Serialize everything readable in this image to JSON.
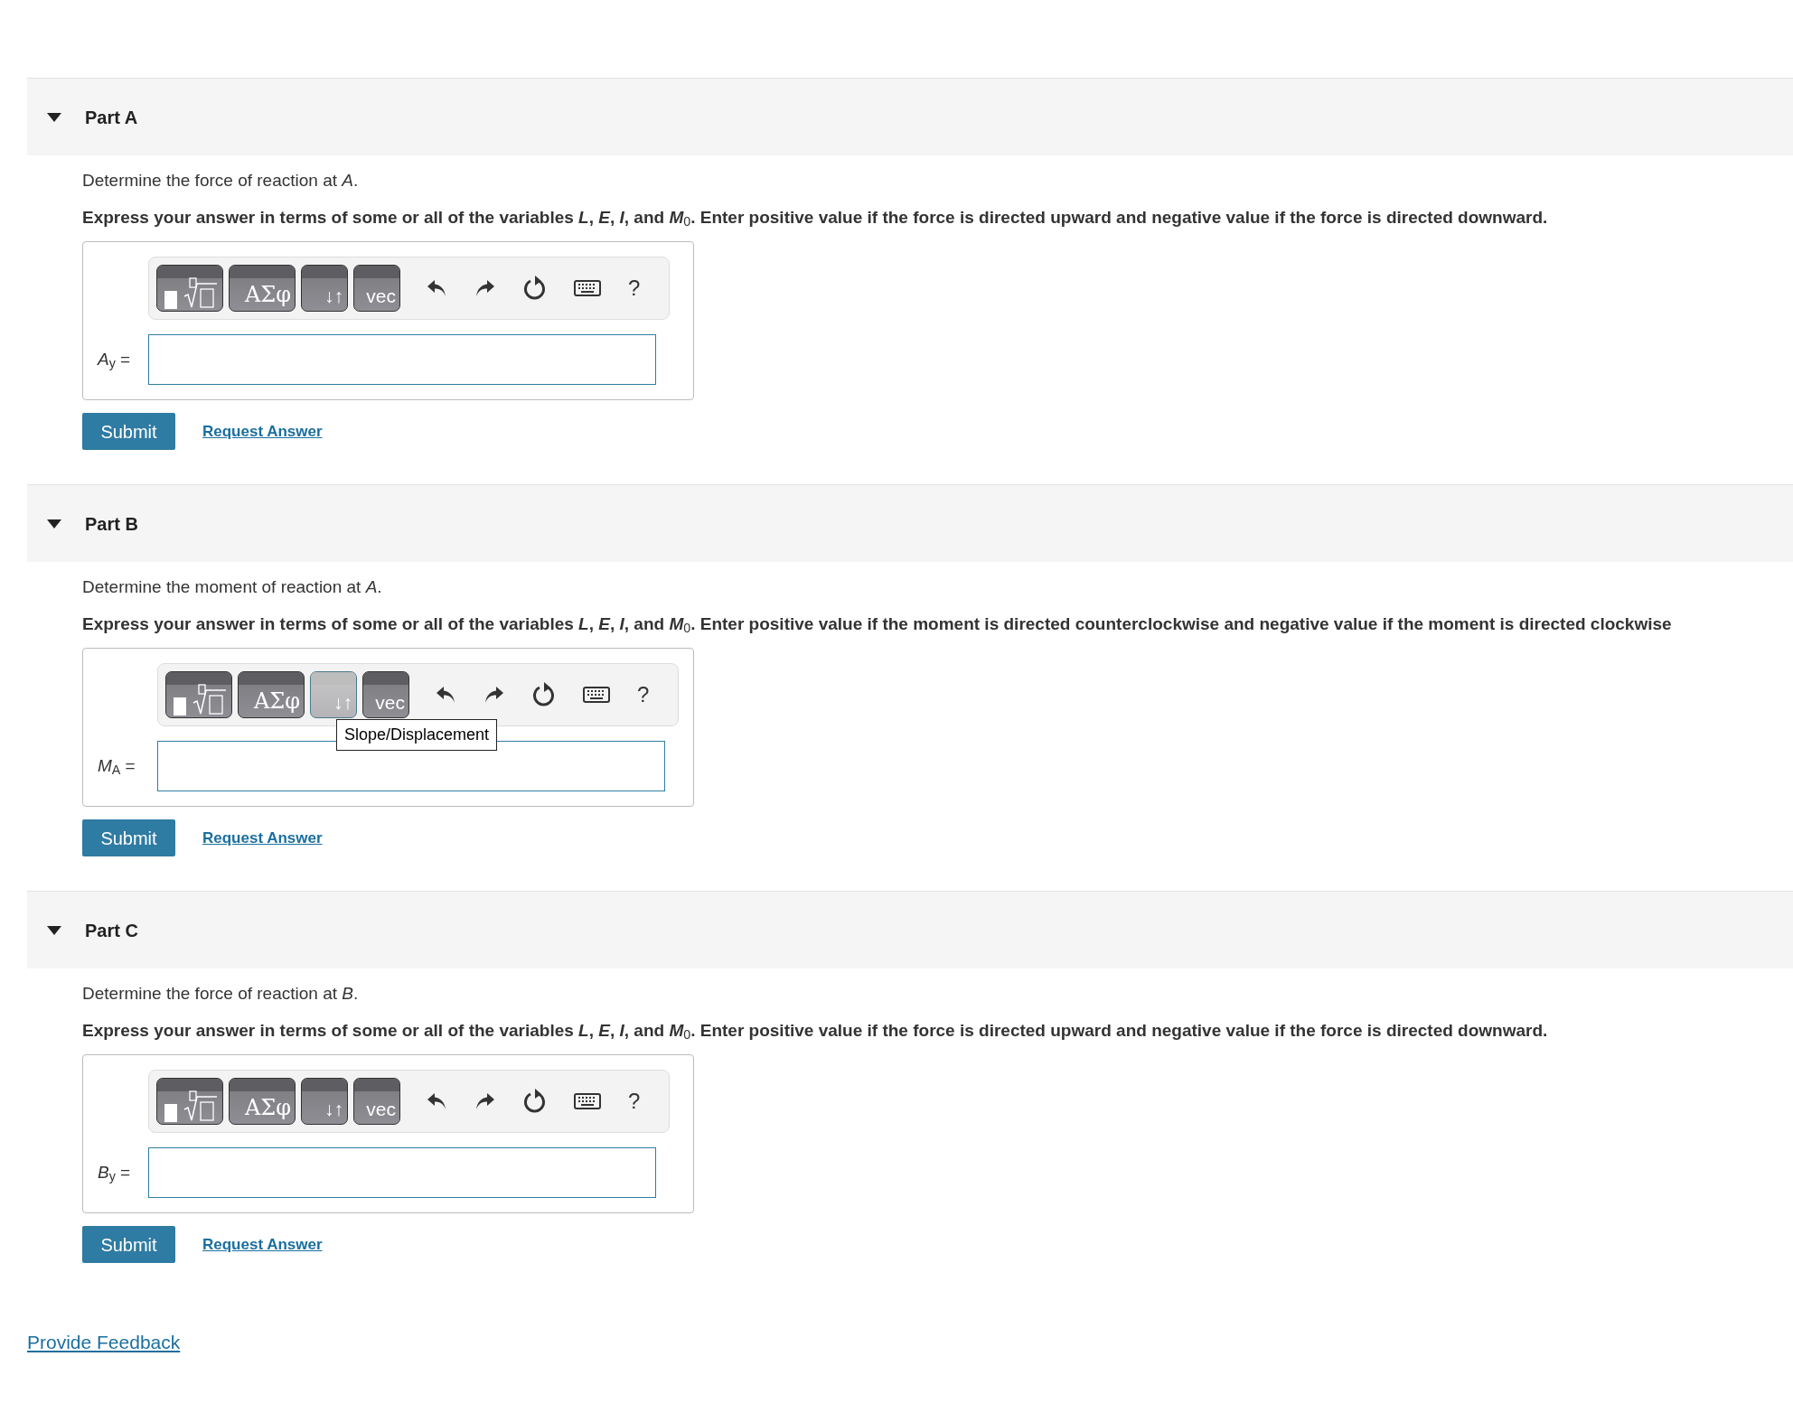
{
  "parts": [
    {
      "title": "Part A",
      "expanded": true,
      "question": "Determine the force of reaction at *A*.",
      "instruction": "Express your answer in terms of some or all of the variables *L*, *E*, *I*, and *M*$_{0}$. Enter positive value if the force is directed upward and negative value if the force is directed downward.",
      "toolbar": [
        {
          "kind": "templates",
          "highlighted": false
        },
        {
          "kind": "symbols",
          "label": "ΑΣφ",
          "highlighted": false
        },
        {
          "kind": "arrows",
          "label": "↓↑",
          "highlighted": false
        },
        {
          "kind": "vector",
          "label": "vec",
          "highlighted": false
        }
      ],
      "help": "?",
      "answer_label": "*A*$_{y}$ =",
      "submit": "Submit",
      "request": "Request Answer"
    },
    {
      "title": "Part B",
      "expanded": true,
      "question": "Determine the moment of reaction at *A*.",
      "instruction": "Express your answer in terms of some or all of the variables *L*, *E*, *I*, and *M*$_{0}$. Enter positive value if the moment is directed counterclockwise and negative value if the moment is directed clockwise",
      "toolbar": [
        {
          "kind": "templates",
          "highlighted": false
        },
        {
          "kind": "symbols",
          "label": "ΑΣφ",
          "highlighted": false
        },
        {
          "kind": "arrows",
          "label": "↓↑",
          "highlighted": true
        },
        {
          "kind": "vector",
          "label": "vec",
          "highlighted": false
        }
      ],
      "tooltip": "Slope/Displacement",
      "help": "?",
      "answer_label": "*M*$_{A}$ =",
      "submit": "Submit",
      "request": "Request Answer"
    },
    {
      "title": "Part C",
      "expanded": true,
      "question": "Determine the force of reaction at *B*.",
      "instruction": "Express your answer in terms of some or all of the variables *L*, *E*, *I*, and *M*$_{0}$. Enter positive value if the force is directed upward and negative value if the force is directed downward.",
      "toolbar": [
        {
          "kind": "templates",
          "highlighted": false
        },
        {
          "kind": "symbols",
          "label": "ΑΣφ",
          "highlighted": false
        },
        {
          "kind": "arrows",
          "label": "↓↑",
          "highlighted": false
        },
        {
          "kind": "vector",
          "label": "vec",
          "highlighted": false
        }
      ],
      "help": "?",
      "answer_label": "*B*$_{y}$ =",
      "submit": "Submit",
      "request": "Request Answer"
    }
  ],
  "feedback": "Provide Feedback"
}
